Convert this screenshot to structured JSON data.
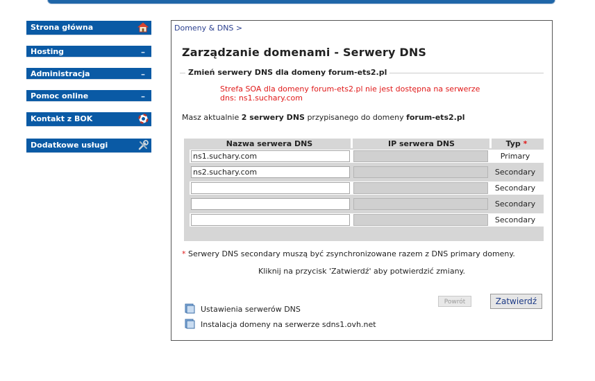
{
  "sidebar": {
    "items": [
      {
        "label": "Strona główna",
        "icon": "home-icon"
      },
      {
        "label": "Hosting",
        "icon": "minus-icon"
      },
      {
        "label": "Administracja",
        "icon": "minus-icon"
      },
      {
        "label": "Pomoc online",
        "icon": "minus-icon"
      },
      {
        "label": "Kontakt z BOK",
        "icon": "lifebuoy-icon"
      },
      {
        "label": "Dodatkowe usługi",
        "icon": "tools-icon"
      }
    ]
  },
  "breadcrumb": "Domeny & DNS >",
  "page_title": "Zarządzanie domenami - Serwery DNS",
  "fieldset_legend": "Zmień serwery DNS dla domeny forum-ets2.pl",
  "error_lines": [
    "Strefa SOA dla domeny forum-ets2.pl nie jest dostępna na serwerze",
    "dns: ns1.suchary.com"
  ],
  "info": {
    "prefix": "Masz aktualnie ",
    "count_text": "2 serwery DNS",
    "middle": " przypisanego do domeny ",
    "domain": "forum-ets2.pl"
  },
  "table": {
    "headers": {
      "name": "Nazwa serwera DNS",
      "ip": "IP serwera DNS",
      "type": "Typ",
      "required_mark": "*"
    },
    "rows": [
      {
        "name": "ns1.suchary.com",
        "ip": "",
        "type": "Primary"
      },
      {
        "name": "ns2.suchary.com",
        "ip": "",
        "type": "Secondary"
      },
      {
        "name": "",
        "ip": "",
        "type": "Secondary"
      },
      {
        "name": "",
        "ip": "",
        "type": "Secondary"
      },
      {
        "name": "",
        "ip": "",
        "type": "Secondary"
      }
    ]
  },
  "note": {
    "mark": "*",
    "text": " Serwery DNS secondary muszą być zsynchronizowane razem z DNS primary domeny."
  },
  "hint": "Kliknij na przycisk 'Zatwierdź' aby potwierdzić zmiany.",
  "buttons": {
    "back": "Powrót",
    "submit": "Zatwierdź"
  },
  "links": [
    {
      "label": "Ustawienia serwerów DNS",
      "icon": "document-icon"
    },
    {
      "label": "Instalacja domeny na serwerze sdns1.ovh.net",
      "icon": "document-icon"
    }
  ],
  "colors": {
    "nav_bg": "#0a5aa5",
    "error": "#e01919",
    "link": "#2a3f8f"
  }
}
